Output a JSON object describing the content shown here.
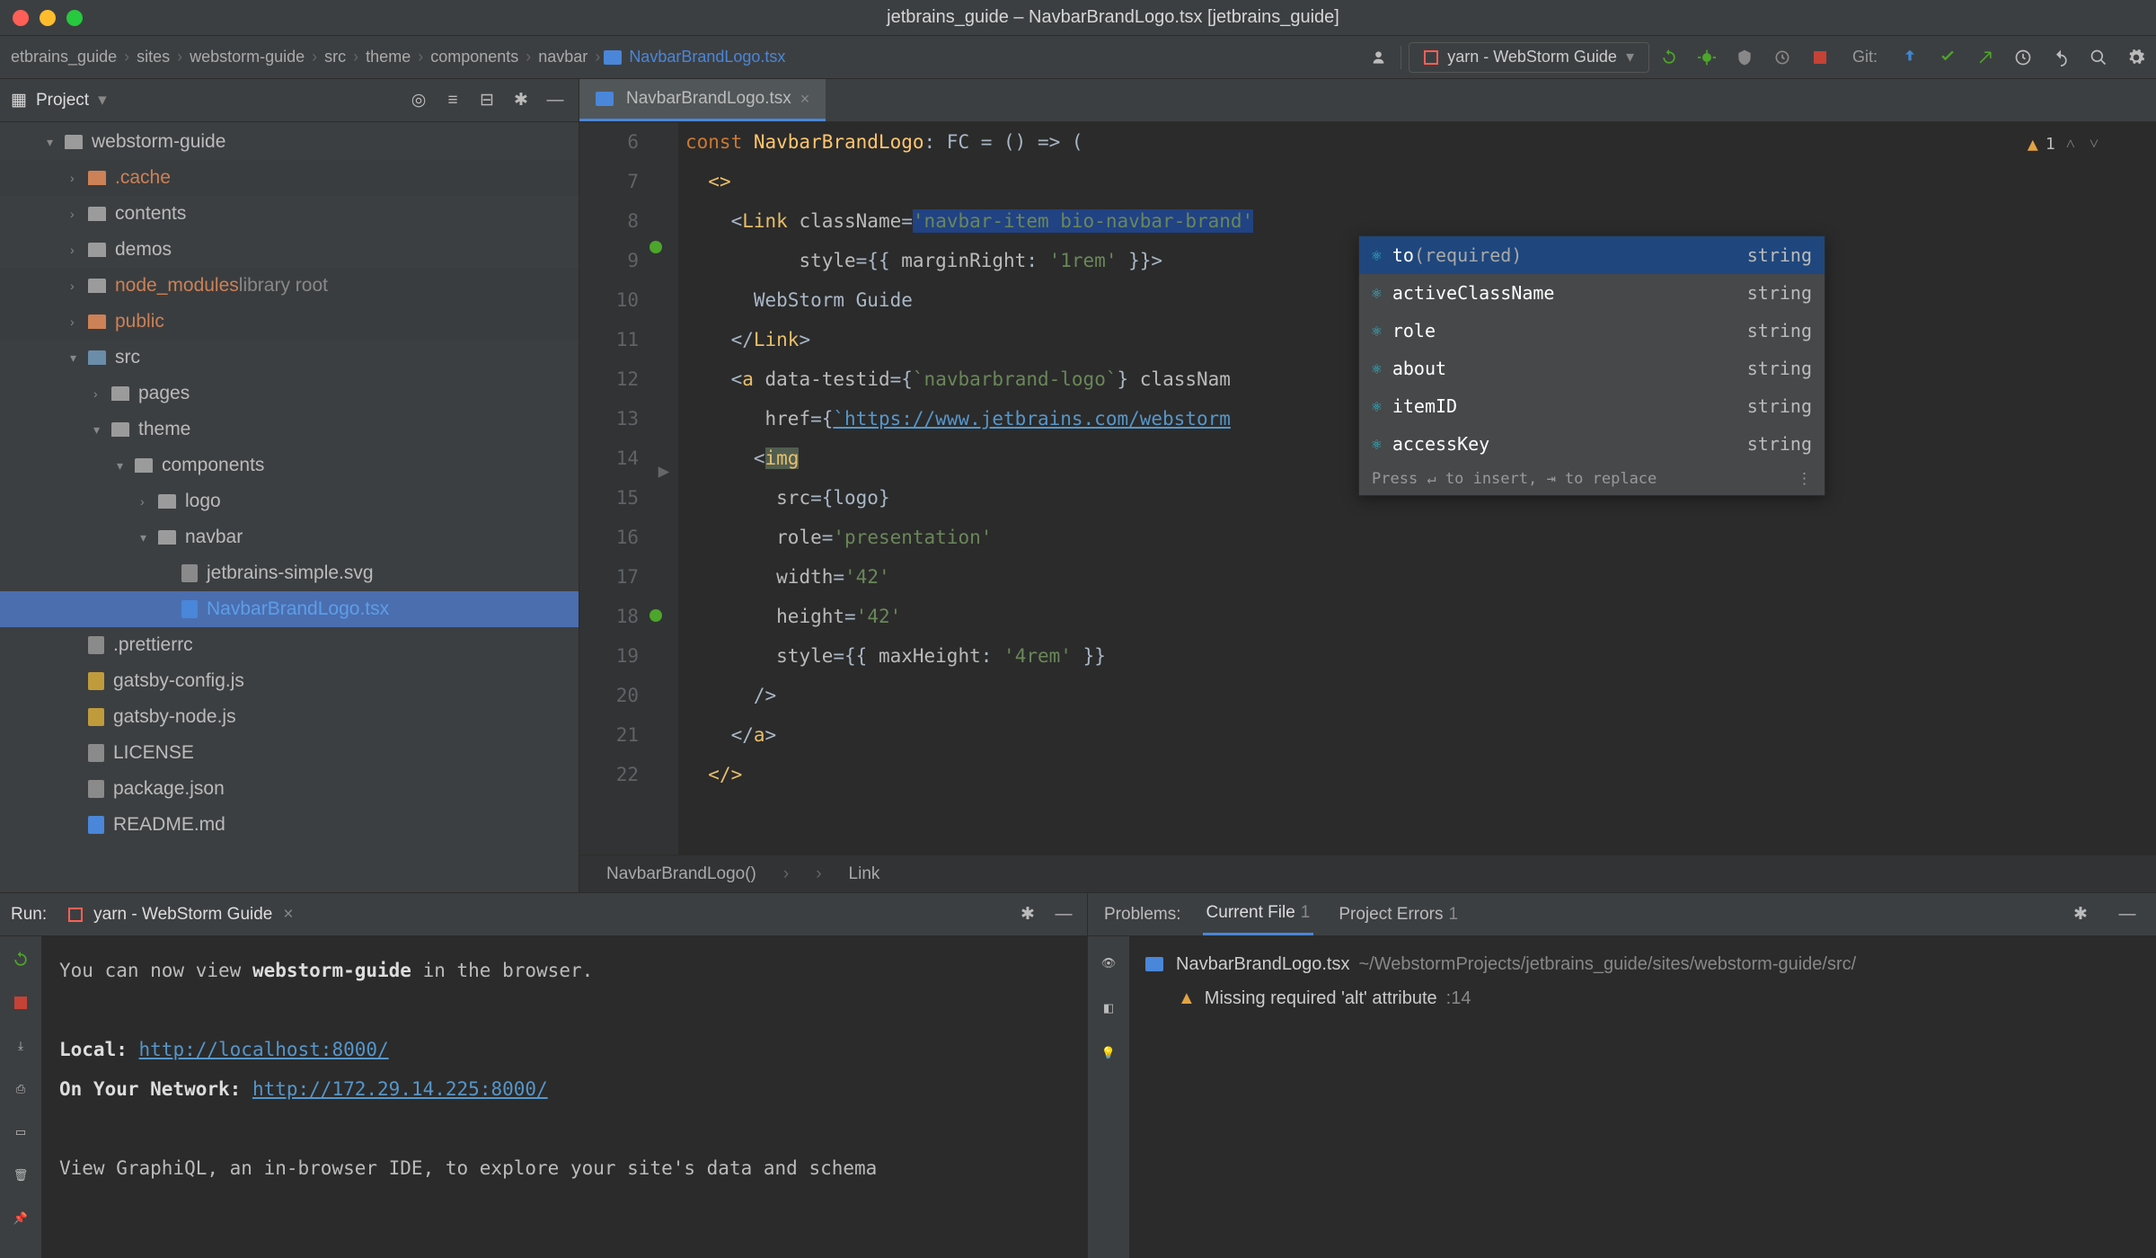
{
  "window": {
    "title": "jetbrains_guide – NavbarBrandLogo.tsx [jetbrains_guide]"
  },
  "breadcrumb": {
    "items": [
      "etbrains_guide",
      "sites",
      "webstorm-guide",
      "src",
      "theme",
      "components",
      "navbar",
      "NavbarBrandLogo.tsx"
    ]
  },
  "runConfig": {
    "label": "yarn - WebStorm Guide"
  },
  "gitLabel": "Git:",
  "projectPane": {
    "title": "Project",
    "items": [
      {
        "indent": 2,
        "chev": "▾",
        "icon": "folder",
        "label": "webstorm-guide"
      },
      {
        "indent": 3,
        "chev": "›",
        "icon": "folder-orange",
        "label": ".cache",
        "labelClass": "orange",
        "dim": true
      },
      {
        "indent": 3,
        "chev": "›",
        "icon": "folder",
        "label": "contents"
      },
      {
        "indent": 3,
        "chev": "›",
        "icon": "folder",
        "label": "demos"
      },
      {
        "indent": 3,
        "chev": "›",
        "icon": "folder",
        "label": "node_modules",
        "labelClass": "node",
        "suffix": "library root",
        "dim": true
      },
      {
        "indent": 3,
        "chev": "›",
        "icon": "folder-orange",
        "label": "public",
        "labelClass": "orange",
        "dim": true
      },
      {
        "indent": 3,
        "chev": "▾",
        "icon": "folder-blue",
        "label": "src"
      },
      {
        "indent": 4,
        "chev": "›",
        "icon": "folder",
        "label": "pages"
      },
      {
        "indent": 4,
        "chev": "▾",
        "icon": "folder",
        "label": "theme"
      },
      {
        "indent": 5,
        "chev": "▾",
        "icon": "folder",
        "label": "components"
      },
      {
        "indent": 6,
        "chev": "›",
        "icon": "folder",
        "label": "logo"
      },
      {
        "indent": 6,
        "chev": "▾",
        "icon": "folder",
        "label": "navbar"
      },
      {
        "indent": 7,
        "chev": "",
        "icon": "file",
        "label": "jetbrains-simple.svg"
      },
      {
        "indent": 7,
        "chev": "",
        "icon": "file-ts",
        "label": "NavbarBrandLogo.tsx",
        "labelClass": "active",
        "highlighted": true
      },
      {
        "indent": 3,
        "chev": "",
        "icon": "file",
        "label": ".prettierrc"
      },
      {
        "indent": 3,
        "chev": "",
        "icon": "file-js",
        "label": "gatsby-config.js"
      },
      {
        "indent": 3,
        "chev": "",
        "icon": "file-js",
        "label": "gatsby-node.js"
      },
      {
        "indent": 3,
        "chev": "",
        "icon": "file",
        "label": "LICENSE"
      },
      {
        "indent": 3,
        "chev": "",
        "icon": "file",
        "label": "package.json"
      },
      {
        "indent": 3,
        "chev": "",
        "icon": "file-md",
        "label": "README.md"
      }
    ]
  },
  "editor": {
    "tabName": "NavbarBrandLogo.tsx",
    "warnCount": "1",
    "lines": {
      "l6a": "const ",
      "l6b": "NavbarBrandLogo",
      "l6c": ": FC = () => (",
      "l7": "<>",
      "l8a": "<",
      "l8b": "Link ",
      "l8c": "className",
      "l8d": "=",
      "l8e": "'navbar-item bio-navbar-brand'",
      "l9a": "style",
      "l9b": "={{ ",
      "l9c": "marginRight",
      "l9d": ": ",
      "l9e": "'1rem' ",
      "l9f": "}}>",
      "l10": "WebStorm Guide",
      "l11a": "</",
      "l11b": "Link",
      "l11c": ">",
      "l12a": "<",
      "l12b": "a ",
      "l12c": "data-testid",
      "l12d": "={",
      "l12e": "`navbarbrand-logo`",
      "l12f": "} ",
      "l12g": "classNam",
      "l13a": "href",
      "l13b": "={",
      "l13c": "`https://www.jetbrains.com/webstorm",
      "l13d": "",
      "l14a": "<",
      "l14b": "img",
      "l15a": "src",
      "l15b": "={logo}",
      "l16a": "role",
      "l16b": "=",
      "l16c": "'presentation'",
      "l17a": "width",
      "l17b": "=",
      "l17c": "'42'",
      "l18a": "height",
      "l18b": "=",
      "l18c": "'42'",
      "l19a": "style",
      "l19b": "={{ ",
      "l19c": "maxHeight",
      "l19d": ": ",
      "l19e": "'4rem' ",
      "l19f": "}}",
      "l20": "/>",
      "l21a": "</",
      "l21b": "a",
      "l21c": ">",
      "l22": "</>"
    },
    "footer": {
      "fn": "NavbarBrandLogo()",
      "el": "Link"
    }
  },
  "autocomplete": {
    "items": [
      {
        "name": "to",
        "required": "(required)",
        "type": "string"
      },
      {
        "name": "activeClassName",
        "required": "",
        "type": "string"
      },
      {
        "name": "role",
        "required": "",
        "type": "string"
      },
      {
        "name": "about",
        "required": "",
        "type": "string"
      },
      {
        "name": "itemID",
        "required": "",
        "type": "string"
      },
      {
        "name": "accessKey",
        "required": "",
        "type": "string"
      }
    ],
    "hint": "Press ↵ to insert, ⇥ to replace"
  },
  "run": {
    "label": "Run:",
    "config": "yarn - WebStorm Guide",
    "line1a": "You can now view ",
    "line1b": "webstorm-guide",
    "line1c": " in the browser.",
    "localLabel": "Local:",
    "localUrl": "http://localhost:8000/",
    "netLabel": "On Your Network:",
    "netUrl": "http://172.29.14.225:8000/",
    "gql": "View GraphiQL, an in-browser IDE, to explore your site's data and schema"
  },
  "problems": {
    "label": "Problems:",
    "tabCurrent": "Current File",
    "tabCurrentCount": "1",
    "tabProject": "Project Errors",
    "tabProjectCount": "1",
    "file": "NavbarBrandLogo.tsx",
    "filePath": "~/WebstormProjects/jetbrains_guide/sites/webstorm-guide/src/",
    "item": "Missing required 'alt' attribute",
    "itemLoc": ":14"
  }
}
